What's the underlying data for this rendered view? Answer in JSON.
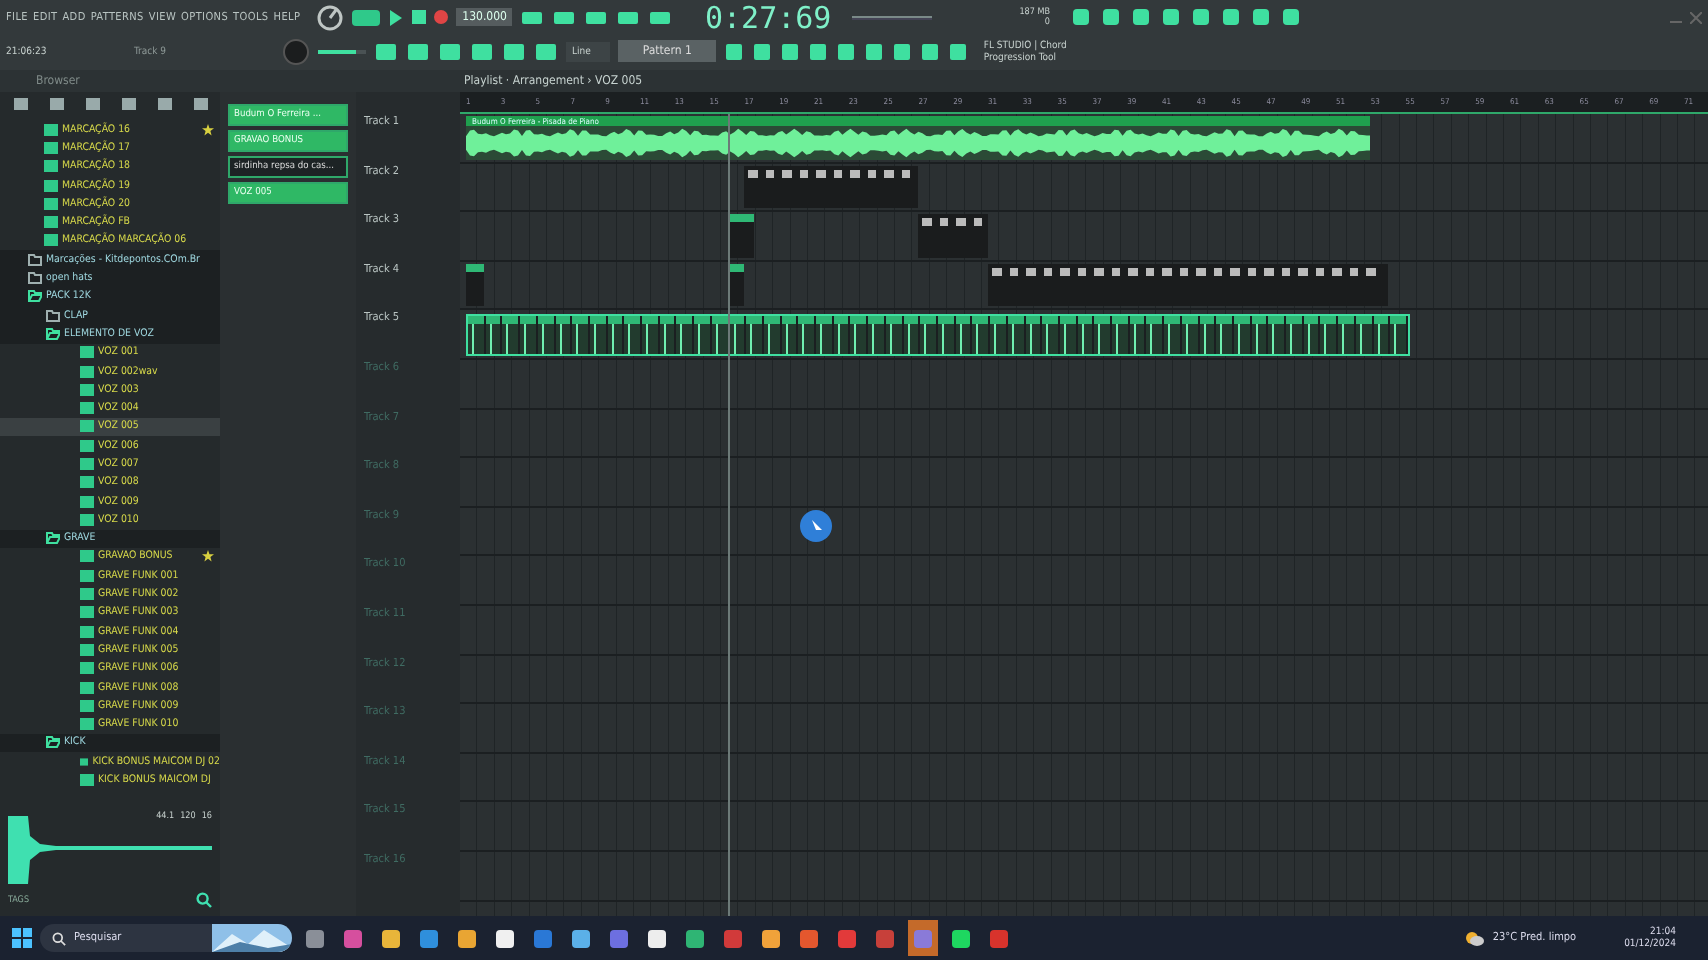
{
  "menu": [
    "FILE",
    "EDIT",
    "ADD",
    "PATTERNS",
    "VIEW",
    "OPTIONS",
    "TOOLS",
    "HELP"
  ],
  "transport": {
    "tempo": "130.000",
    "time": "0:27:69",
    "memory": "187 MB",
    "voices": "0",
    "song_mode": true
  },
  "info": {
    "volume": {
      "level": 0.8
    },
    "clock": "21:06:23",
    "target": "Track 9",
    "snap": "Line",
    "pattern": "Pattern 1",
    "hint_title": "FL STUDIO | Chord",
    "hint_text": "Progression Tool"
  },
  "browser": {
    "title": "Browser",
    "items": [
      {
        "label": "MARCAÇÃO 16",
        "kind": "file",
        "starred": true
      },
      {
        "label": "MARCAÇÃO 17",
        "kind": "file",
        "starred": false
      },
      {
        "label": "MARCAÇÃO 18",
        "kind": "file",
        "starred": false
      },
      {
        "label": "MARCAÇÃO 19",
        "kind": "file",
        "starred": false
      },
      {
        "label": "MARCAÇÃO 20",
        "kind": "file",
        "starred": false
      },
      {
        "label": "MARCAÇÃO FB",
        "kind": "file",
        "starred": false
      },
      {
        "label": "MARCAÇÃO MARCAÇÃO 06",
        "kind": "file",
        "starred": false
      },
      {
        "label": "Marcações - Kitdepontos.COm.Br",
        "kind": "folder",
        "expanded": false
      },
      {
        "label": "open hats",
        "kind": "folder",
        "expanded": false
      },
      {
        "label": "PACK 12K",
        "kind": "folder",
        "expanded": true,
        "children": [
          {
            "label": "CLAP",
            "kind": "folder",
            "expanded": false
          },
          {
            "label": "ELEMENTO DE VOZ",
            "kind": "folder",
            "expanded": true,
            "children": [
              {
                "label": "VOZ 001",
                "kind": "file",
                "starred": false,
                "selected": false
              },
              {
                "label": "VOZ 002wav",
                "kind": "file",
                "starred": false,
                "selected": false
              },
              {
                "label": "VOZ 003",
                "kind": "file",
                "starred": false,
                "selected": false
              },
              {
                "label": "VOZ 004",
                "kind": "file",
                "starred": false,
                "selected": false
              },
              {
                "label": "VOZ 005",
                "kind": "file",
                "starred": false,
                "selected": true
              },
              {
                "label": "VOZ 006",
                "kind": "file",
                "starred": false,
                "selected": false
              },
              {
                "label": "VOZ 007",
                "kind": "file",
                "starred": false,
                "selected": false
              },
              {
                "label": "VOZ 008",
                "kind": "file",
                "starred": false,
                "selected": false
              },
              {
                "label": "VOZ 009",
                "kind": "file",
                "starred": false,
                "selected": false
              },
              {
                "label": "VOZ 010",
                "kind": "file",
                "starred": false,
                "selected": false
              }
            ]
          },
          {
            "label": "GRAVE",
            "kind": "folder",
            "expanded": true,
            "children": [
              {
                "label": "GRAVAO BONUS",
                "kind": "file",
                "starred": true
              },
              {
                "label": "GRAVE FUNK 001",
                "kind": "file",
                "starred": false
              },
              {
                "label": "GRAVE FUNK 002",
                "kind": "file",
                "starred": false
              },
              {
                "label": "GRAVE FUNK 003",
                "kind": "file",
                "starred": false
              },
              {
                "label": "GRAVE FUNK 004",
                "kind": "file",
                "starred": false
              },
              {
                "label": "GRAVE FUNK 005",
                "kind": "file",
                "starred": false
              },
              {
                "label": "GRAVE FUNK 006",
                "kind": "file",
                "starred": false
              },
              {
                "label": "GRAVE FUNK 008",
                "kind": "file",
                "starred": false
              },
              {
                "label": "GRAVE FUNK 009",
                "kind": "file",
                "starred": false
              },
              {
                "label": "GRAVE FUNK 010",
                "kind": "file",
                "starred": false
              }
            ]
          },
          {
            "label": "KICK",
            "kind": "folder",
            "expanded": true,
            "children": [
              {
                "label": "KICK BONUS MAICOM DJ 02",
                "kind": "file",
                "starred": false
              },
              {
                "label": "KICK BONUS MAICOM DJ",
                "kind": "file",
                "starred": false
              }
            ]
          }
        ]
      }
    ],
    "preview": {
      "rate": "44.1",
      "tempo": "120",
      "bits": "16",
      "tags": "TAGS"
    }
  },
  "picker": [
    {
      "label": "Budum O Ferreira ...",
      "selected": true
    },
    {
      "label": "GRAVAO BONUS",
      "selected": true
    },
    {
      "label": "sirdinha  repsa do cas...",
      "selected": false
    },
    {
      "label": "VOZ 005",
      "selected": true
    }
  ],
  "playlist": {
    "title": "Playlist · Arrangement › VOZ 005",
    "ruler": [
      "1",
      "3",
      "5",
      "7",
      "9",
      "11",
      "13",
      "15",
      "17",
      "19",
      "21",
      "23",
      "25",
      "27",
      "29",
      "31",
      "33",
      "35",
      "37",
      "39",
      "41",
      "43",
      "45",
      "47",
      "49",
      "51",
      "53",
      "55",
      "57",
      "59",
      "61",
      "63",
      "65",
      "67",
      "69",
      "71"
    ],
    "tracks": [
      {
        "name": "Track 1",
        "clips": [
          {
            "kind": "audio",
            "title": "Budum O Ferreira - Pisada de Piano"
          }
        ]
      },
      {
        "name": "Track 2",
        "clips": [
          {
            "kind": "pattern"
          }
        ]
      },
      {
        "name": "Track 3",
        "clips": [
          {
            "kind": "sample"
          },
          {
            "kind": "pattern"
          }
        ]
      },
      {
        "name": "Track 4",
        "clips": [
          {
            "kind": "sample"
          },
          {
            "kind": "sample"
          },
          {
            "kind": "pattern"
          }
        ]
      },
      {
        "name": "Track 5",
        "clips": [
          {
            "kind": "loop"
          }
        ]
      },
      {
        "name": "Track 6"
      },
      {
        "name": "Track 7"
      },
      {
        "name": "Track 8"
      },
      {
        "name": "Track 9"
      },
      {
        "name": "Track 10"
      },
      {
        "name": "Track 11"
      },
      {
        "name": "Track 12"
      },
      {
        "name": "Track 13"
      },
      {
        "name": "Track 14"
      },
      {
        "name": "Track 15"
      },
      {
        "name": "Track 16"
      }
    ]
  },
  "taskbar": {
    "search": "Pesquisar",
    "apps": [
      {
        "color": "#8a8f98",
        "selected": false
      },
      {
        "color": "#d64f9e",
        "selected": false
      },
      {
        "color": "#e8b53a",
        "selected": false
      },
      {
        "color": "#2f8fdc",
        "selected": false
      },
      {
        "color": "#e9a533",
        "selected": false
      },
      {
        "color": "#f0f0f0",
        "selected": false
      },
      {
        "color": "#2a78d6",
        "selected": false
      },
      {
        "color": "#5bb0e8",
        "selected": false
      },
      {
        "color": "#6d6fe0",
        "selected": false
      },
      {
        "color": "#ededed",
        "selected": false
      },
      {
        "color": "#2fb574",
        "selected": false
      },
      {
        "color": "#d13a3a",
        "selected": false
      },
      {
        "color": "#f0a23a",
        "selected": false
      },
      {
        "color": "#e4572e",
        "selected": false
      },
      {
        "color": "#e23a3a",
        "selected": false
      },
      {
        "color": "#c7403a",
        "selected": false
      },
      {
        "color": "#8a7ad8",
        "selected": true
      },
      {
        "color": "#1ed760",
        "selected": false
      },
      {
        "color": "#d8332c",
        "selected": false
      }
    ],
    "weather": "23°C  Pred. limpo",
    "time": "21:04",
    "date": "01/12/2024"
  }
}
